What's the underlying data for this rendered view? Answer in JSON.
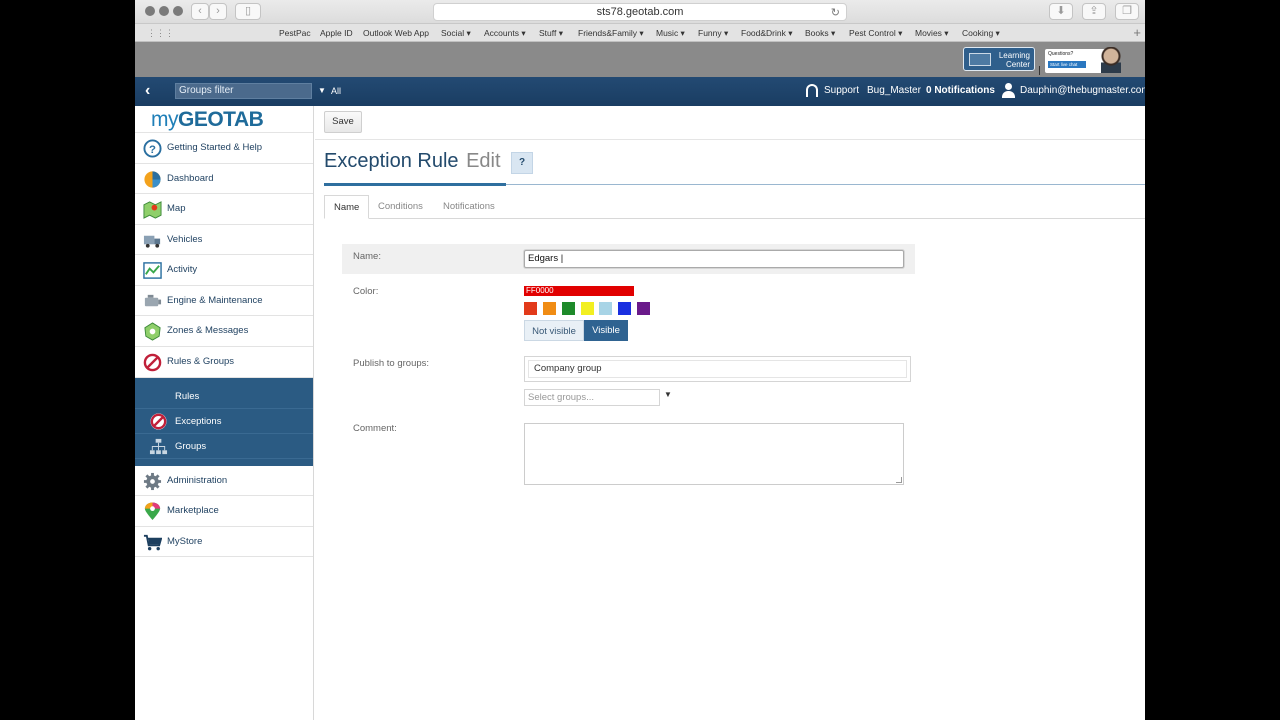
{
  "browser": {
    "url": "sts78.geotab.com",
    "bookmarks": [
      "PestPac",
      "Apple ID",
      "Outlook Web App",
      "Social ▾",
      "Accounts ▾",
      "Stuff ▾",
      "Friends&Family ▾",
      "Music ▾",
      "Funny ▾",
      "Food&Drink ▾",
      "Books ▾",
      "Pest Control ▾",
      "Movies ▾",
      "Cooking ▾"
    ]
  },
  "banner": {
    "learning_line1": "Learning",
    "learning_line2": "Center",
    "questions": "Questions?",
    "chat": "Start live chat"
  },
  "header": {
    "groups_filter": "Groups filter",
    "all": "All",
    "support": "Support",
    "account": "Bug_Master",
    "notifications": "0 Notifications",
    "user": "Dauphin@thebugmaster.com"
  },
  "sidebar": {
    "logo_my": "my",
    "logo_geotab": "GEOTAB",
    "items": [
      {
        "label": "Getting Started & Help"
      },
      {
        "label": "Dashboard"
      },
      {
        "label": "Map"
      },
      {
        "label": "Vehicles"
      },
      {
        "label": "Activity"
      },
      {
        "label": "Engine & Maintenance"
      },
      {
        "label": "Zones & Messages"
      },
      {
        "label": "Rules & Groups"
      }
    ],
    "subitems": [
      {
        "label": "Rules"
      },
      {
        "label": "Exceptions"
      },
      {
        "label": "Groups"
      }
    ],
    "bottom_items": [
      {
        "label": "Administration"
      },
      {
        "label": "Marketplace"
      },
      {
        "label": "MyStore"
      }
    ]
  },
  "main": {
    "save": "Save",
    "title": "Exception Rule",
    "title_suffix": "Edit",
    "help": "?",
    "tabs": [
      "Name",
      "Conditions",
      "Notifications"
    ],
    "form": {
      "name_label": "Name:",
      "name_value": "Edgars |",
      "color_label": "Color:",
      "color_value": "FF0000",
      "swatches": [
        "#e23a1a",
        "#f08c14",
        "#1e8a2a",
        "#f2ef21",
        "#a8d4e6",
        "#1a2fe0",
        "#6a1a8a"
      ],
      "not_visible": "Not visible",
      "visible": "Visible",
      "publish_label": "Publish to groups:",
      "publish_value": "Company group",
      "select_placeholder": "Select groups...",
      "comment_label": "Comment:"
    }
  },
  "colors": {
    "header_bg": "#1f4670",
    "sidebar_active": "#2b5b83",
    "title": "#234a6c"
  }
}
